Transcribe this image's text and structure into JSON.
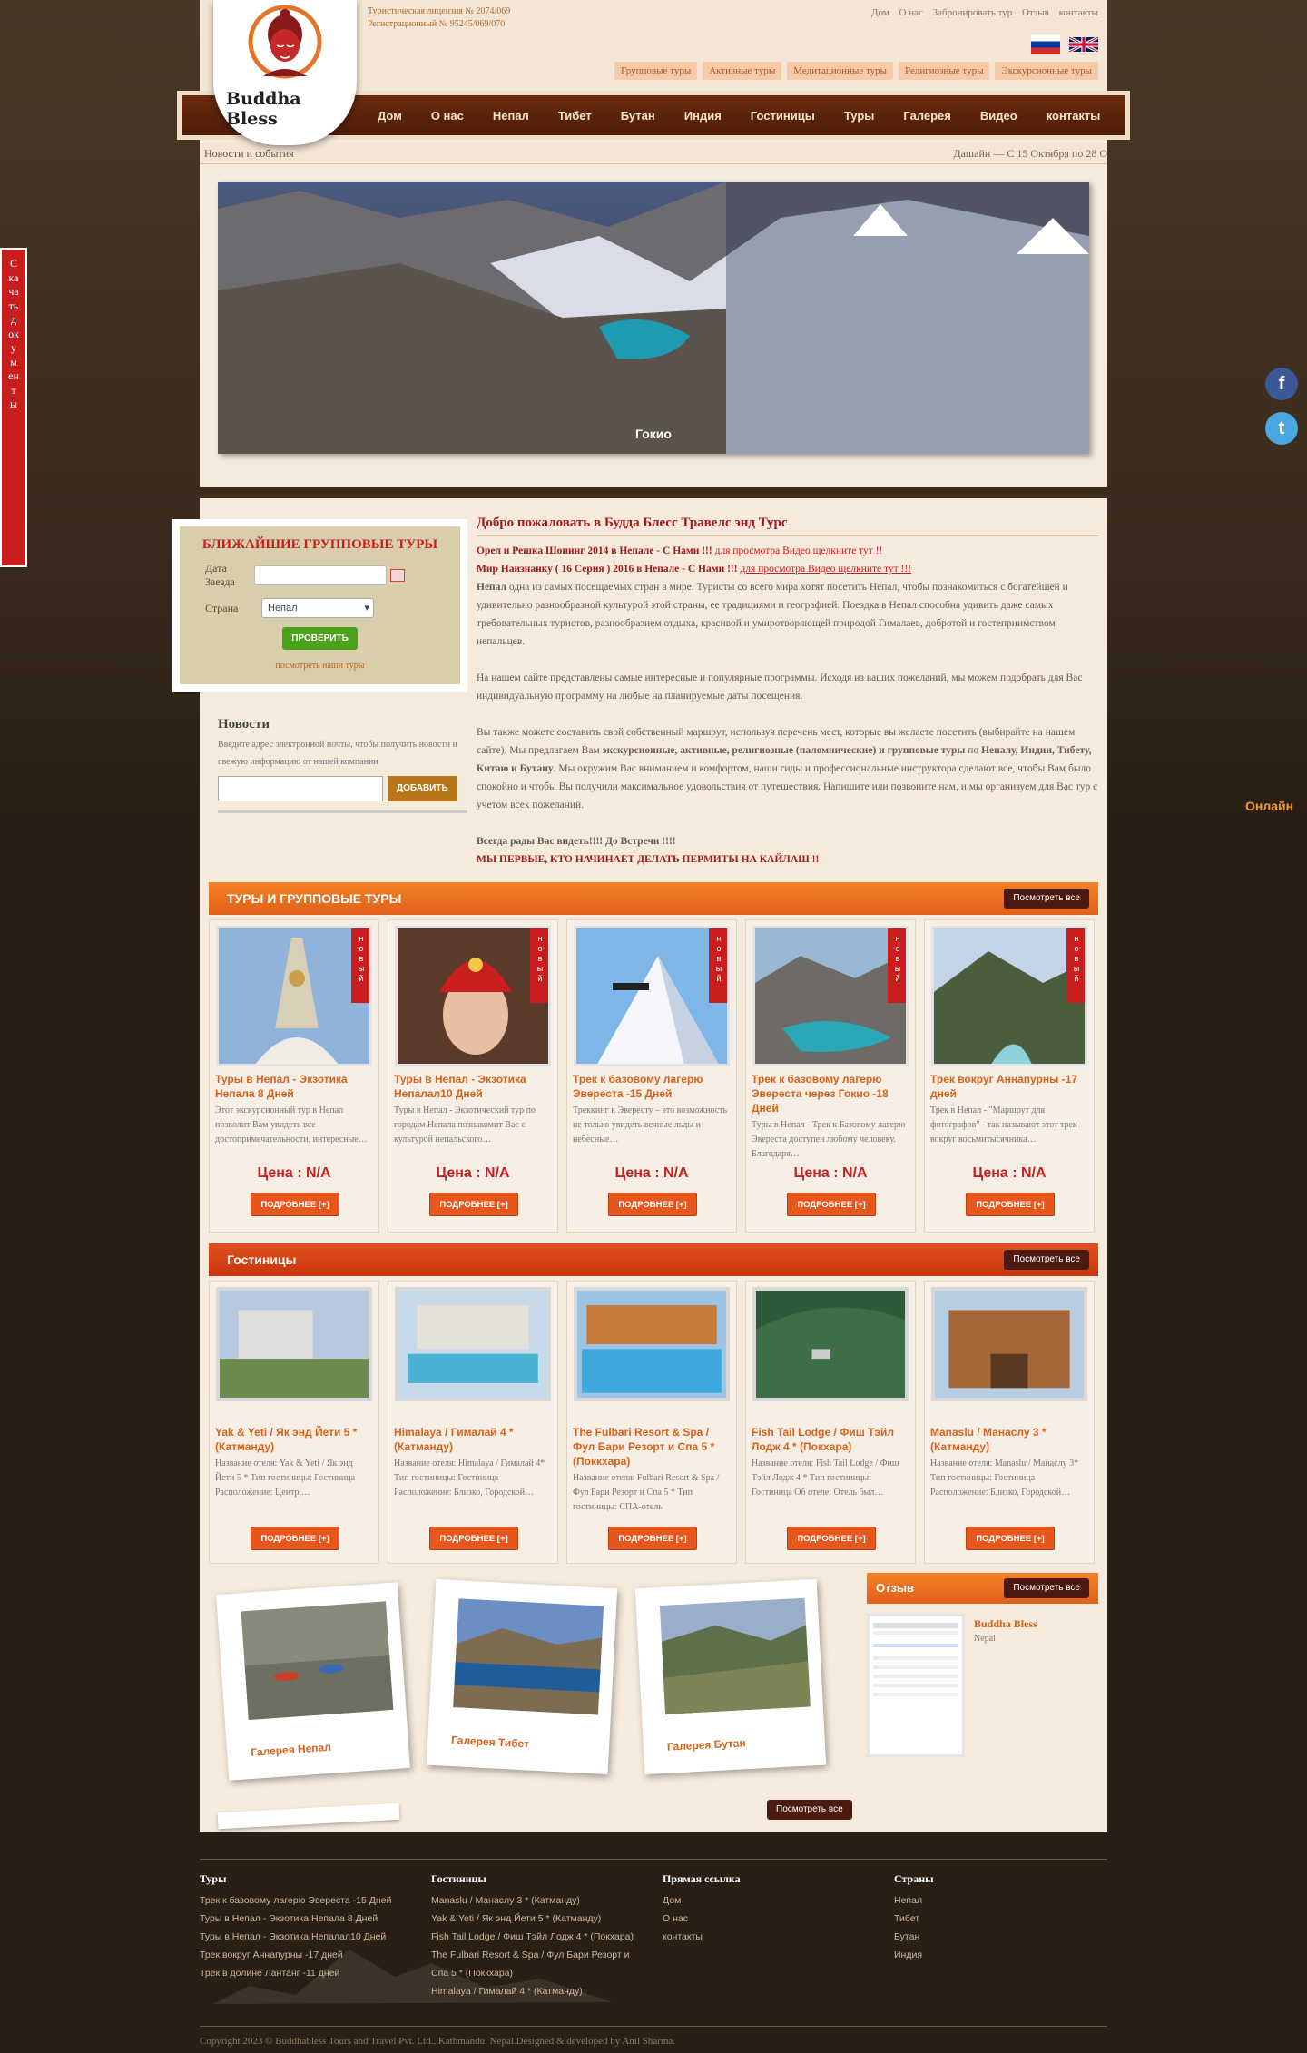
{
  "header": {
    "license": [
      "Туристическая лицензия № 2074/069",
      "Регистрационный № 95245/069/070"
    ],
    "top_links": [
      "Дом",
      "О нас",
      "Забронировать тур",
      "Отзыв",
      "контакты"
    ],
    "tags": [
      "Групповые туры",
      "Активные туры",
      "Медитационные туры",
      "Религиозные туры",
      "Экскурсионные туры"
    ],
    "logo_text": "Buddha Bless"
  },
  "nav": [
    "Дом",
    "О нас",
    "Непал",
    "Тибет",
    "Бутан",
    "Индия",
    "Гостиницы",
    "Туры",
    "Галерея",
    "Видео",
    "контакты"
  ],
  "news_bar": {
    "label": "Новости и события",
    "message": "Дашайн  — С 15 Октября по 28 О"
  },
  "slider": {
    "caption": "Гокио"
  },
  "side_tab": "Скачать документы",
  "online_label": "Онлайн",
  "group_tours": {
    "title": "БЛИЖАЙШИЕ ГРУППОВЫЕ ТУРЫ",
    "date_label": "Дата Заезда",
    "country_label": "Страна",
    "country_value": "Непал",
    "check_button": "ПРОВЕРИТЬ",
    "see_tours": "посмотреть наши туры"
  },
  "newsletter": {
    "title": "Новости",
    "text": "Введите адрес электронной почты, чтобы получить новости и свежую информацию от нашей компании",
    "button": "ДОБАВИТЬ"
  },
  "welcome": {
    "title": "Добро пожаловать в Будда Блесс Травелс энд Турс",
    "video1_text": "Орел и Решка Шопинг 2014 в Непале - С Нами !!!",
    "video1_link": "для просмотра Видео щелкните тут !!",
    "video2_text": "Мир Наизнанку ( 16 Серия ) 2016 в Непале - С Нами !!!",
    "video2_link": "для просмотра Видео щелкните тут !!!",
    "p1_bold": "Непал",
    "p1": " одна из самых посещаемых стран в мире. Туристы со всего мира хотят посетить Непал, чтобы познакомиться с богатейшей и удивительно разнообразной культурой этой страны, ее традициями и географией. Поездка в Непал способна удивить даже самых требовательных туристов, разнообразием отдыха, красивой и умиротворяющей природой Гималаев, добротой и гостеприимством непальцев.",
    "p2": "На нашем сайте представлены самые интересные и популярные программы. Исходя из ваших пожеланий, мы можем подобрать для Вас индивидуальную программу на любые на планируемые даты посещения.",
    "p3a": "Вы также можете составить свой собственный маршрут, используя перечень мест, которые вы желаете посетить (выбирайте на нашем сайте). Мы предлагаем Вам ",
    "p3b": "экскурсионные, активные, религиозные (паломнические) и групповые туры",
    "p3c": " по ",
    "p3d": "Непалу, Индии, Тибету, Китаю и Бутану",
    "p3e": ". Мы окружим Вас вниманием и комфортом, наши гиды и профессиональные инструктора сделают все, чтобы Вам было спокойно и чтобы Вы получили максимальное удовольствия от путешествия. Напишите или позвоните нам, и мы организуем для Вас тур с учетом всех пожеланий.",
    "p4": "Всегда рады Вас видеть!!!! До Встречи !!!!",
    "p5": "МЫ ПЕРВЫЕ, КТО НАЧИНАЕТ ДЕЛАТЬ ПЕРМИТЫ НА КАЙЛАШ !!"
  },
  "tours_section": {
    "title": "ТУРЫ И ГРУППОВЫЕ ТУРЫ",
    "view_all": "Посмотреть все",
    "ribbon": "новый",
    "price": "Цена : N/A",
    "more": "ПОДРОБНЕЕ [+]",
    "items": [
      {
        "title": "Туры в Непал - Экзотика Непала 8 Дней",
        "desc": "Этот экскурсионный тур в Непал позволит Вам увидеть все достопримечательности, интересные…"
      },
      {
        "title": "Туры в Непал - Экзотика Непалал10 Дней",
        "desc": "Туры в Непал - Экзотический тур по городам  Непала познакомит Вас с культурой непальского…"
      },
      {
        "title": "Трек к базовому лагерю Эвереста -15 Дней",
        "desc": "Треккинг к Эвересту – это возможность не только увидеть вечные льды и небесные…"
      },
      {
        "title": "Трек к базовому лагерю Эвереста через Гокио -18 Дней",
        "desc": "Туры в Непал - Трек к Базовому лагерю Эвереста доступен любому человеку. Благодаря…"
      },
      {
        "title": "Трек вокруг Аннапурны -17 дней",
        "desc": "Трек в Непал - \"Маршрут для фотографов\" - так называют этот трек вокруг восьмитысячника…"
      }
    ]
  },
  "hotels_section": {
    "title": "Гостиницы",
    "view_all": "Посмотреть все",
    "more": "ПОДРОБНЕЕ [+]",
    "items": [
      {
        "title": "Yak & Yeti / Як энд Йети 5 * (Катманду)",
        "desc": "Название отеля: Yak & Yeti / Як энд Йети 5 * Тип гостиницы: Гостиница Расположение: Центр,…"
      },
      {
        "title": "Himalaya / Гималай 4 * (Катманду)",
        "desc": "Название отеля: Himalaya / Гималай 4* Тип гостиницы: Гостиница Расположение: Близко, Городской…"
      },
      {
        "title": "The Fulbari Resort & Spa / Фул Бари Резорт и Спа 5 * (Поккхара)",
        "desc": "Название отеля: Fulbari Resort & Spa / Фул Бари Резорт и Спа 5 * Тип гостиницы: СПА-отель"
      },
      {
        "title": "Fish Tail Lodge / Фиш Тэйл Лодж 4 * (Покхара)",
        "desc": "Название отеля: Fish Tail Lodge / Фиш Тэйл Лодж 4 * Тип гостиницы: Гостиница Об отеле: Отель был…"
      },
      {
        "title": "Manaslu / Манаслу 3 * (Катманду)",
        "desc": "Название отеля: Manaslu / Манаслу 3* Тип гостиницы: Гостиница Расположение: Близко, Городской…"
      }
    ]
  },
  "gallery": {
    "items": [
      "Галерея Непал",
      "Галерея Тибет",
      "Галерея Бутан"
    ],
    "view_all": "Посмотреть все"
  },
  "review": {
    "title": "Отзыв",
    "view_all": "Посмотреть все",
    "name": "Buddha Bless",
    "country": "Nepal"
  },
  "footer": {
    "cols": [
      {
        "title": "Туры",
        "links": [
          "Трек к базовому лагерю Эвереста -15 Дней",
          "Туры в Непал - Экзотика Непала 8 Дней",
          "Туры в Непал - Экзотика Непалал10 Дней",
          "Трек вокруг Аннапурны -17 дней",
          "Трек в долине Лантанг -11 дней"
        ]
      },
      {
        "title": "Гостиницы",
        "links": [
          "Manaslu / Манаслу 3 * (Катманду)",
          "Yak & Yeti / Як энд Йети 5 * (Катманду)",
          "Fish Tail Lodge / Фиш Тэйл Лодж 4 * (Покхара)",
          "The Fulbari Resort & Spa / Фул Бари Резорт и Спа 5 * (Поккхара)",
          "Himalaya / Гималай 4 * (Катманду)"
        ]
      },
      {
        "title": "Прямая ссылка",
        "links": [
          "Дом",
          "О нас",
          "контакты"
        ]
      },
      {
        "title": "Страны",
        "links": [
          "Непал",
          "Тибет",
          "Бутан",
          "Индия"
        ]
      }
    ],
    "copyright": "Copyright 2023 © Buddhabless Tours and Travel Pvt. Ltd., Kathmandu, Nepal.Designed & developed by Anil Sharma."
  }
}
